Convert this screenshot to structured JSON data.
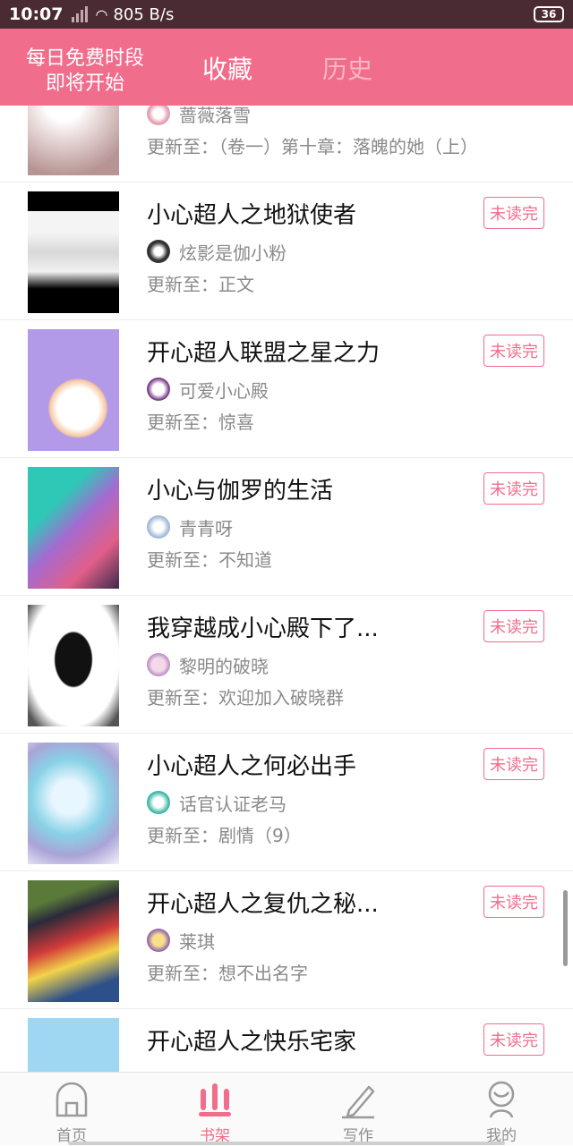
{
  "status_bar": {
    "time": "10:07",
    "speed": "805 B/s",
    "battery": "36"
  },
  "header": {
    "free_time_line1": "每日免费时段",
    "free_time_line2": "即将开始",
    "tab_favorites": "收藏",
    "tab_history": "历史"
  },
  "books": [
    {
      "title": "",
      "author": "蔷薇落雪",
      "update": "更新至：（卷一）第十章：落魄的她（上）",
      "badge": ""
    },
    {
      "title": "小心超人之地狱使者",
      "author": "炫影是伽小粉",
      "update": "更新至：正文",
      "badge": "未读完"
    },
    {
      "title": "开心超人联盟之星之力",
      "author": "可爱小心殿",
      "update": "更新至：惊喜",
      "badge": "未读完"
    },
    {
      "title": "小心与伽罗的生活",
      "author": "青青呀",
      "update": "更新至：不知道",
      "badge": "未读完"
    },
    {
      "title": "我穿越成小心殿下了...",
      "author": "黎明的破晓",
      "update": "更新至：欢迎加入破晓群",
      "badge": "未读完"
    },
    {
      "title": "小心超人之何必出手",
      "author": "话官认证老马",
      "update": "更新至：剧情（9）",
      "badge": "未读完"
    },
    {
      "title": "开心超人之复仇之秘...",
      "author": "莱琪",
      "update": "更新至：想不出名字",
      "badge": "未读完"
    },
    {
      "title": "开心超人之快乐宅家",
      "author": "",
      "update": "",
      "badge": "未读完"
    }
  ],
  "nav": [
    {
      "label": "首页",
      "icon": "home-icon"
    },
    {
      "label": "书架",
      "icon": "bookshelf-icon"
    },
    {
      "label": "写作",
      "icon": "pencil-icon"
    },
    {
      "label": "我的",
      "icon": "profile-icon"
    }
  ],
  "colors": {
    "accent": "#f16d8c",
    "status_bar": "#4a2a33"
  }
}
